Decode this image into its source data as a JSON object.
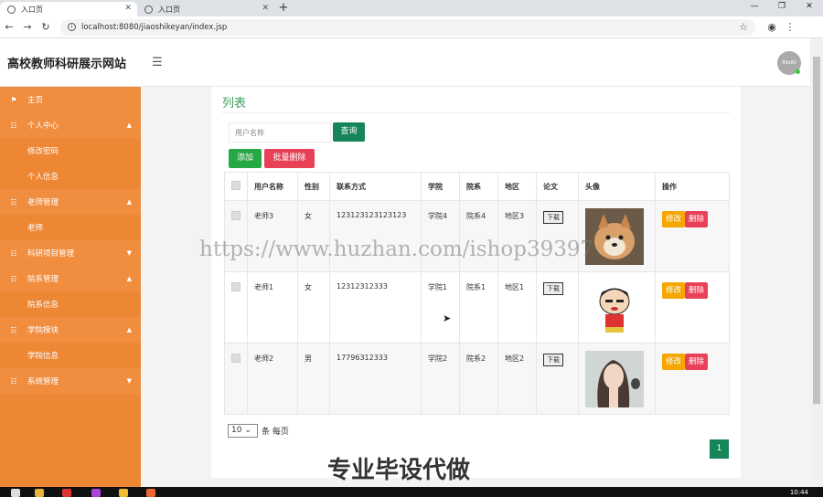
{
  "browser": {
    "tabs": [
      {
        "label": "入口页"
      },
      {
        "label": "入口页"
      }
    ],
    "url": "localhost:8080/jiaoshikeyan/index.jsp",
    "new_tab": "+",
    "win": {
      "min": "—",
      "max": "❐",
      "close": "✕"
    }
  },
  "header": {
    "title": "高校教师科研展示网站",
    "avatar_text": "80x80"
  },
  "sidebar": {
    "items": [
      {
        "label": "主页",
        "type": "main",
        "icon": "flag-icon"
      },
      {
        "label": "个人中心",
        "type": "main",
        "caret": "▲"
      },
      {
        "label": "修改密码",
        "type": "sub"
      },
      {
        "label": "个人信息",
        "type": "sub"
      },
      {
        "label": "老师管理",
        "type": "main",
        "caret": "▲"
      },
      {
        "label": "老师",
        "type": "sub"
      },
      {
        "label": "科研项目管理",
        "type": "main",
        "caret": "▼"
      },
      {
        "label": "院系管理",
        "type": "main",
        "caret": "▲"
      },
      {
        "label": "院系信息",
        "type": "sub"
      },
      {
        "label": "学院模块",
        "type": "main",
        "caret": "▲"
      },
      {
        "label": "学院信息",
        "type": "sub"
      },
      {
        "label": "系统管理",
        "type": "main",
        "caret": "▼"
      }
    ]
  },
  "main": {
    "title": "列表",
    "search_placeholder": "用户名称",
    "query_button": "查询",
    "add_button": "添加",
    "batch_delete_button": "批量删除",
    "columns": [
      "用户名称",
      "性别",
      "联系方式",
      "学院",
      "院系",
      "地区",
      "论文",
      "头像",
      "操作"
    ],
    "rows": [
      {
        "name": "老师3",
        "gender": "女",
        "contact": "123123123123123",
        "college": "学院4",
        "dept": "院系4",
        "region": "地区3",
        "paper": "下载",
        "avatar": "shiba-dog-photo"
      },
      {
        "name": "老师1",
        "gender": "女",
        "contact": "12312312333",
        "college": "学院1",
        "dept": "院系1",
        "region": "地区1",
        "paper": "下载",
        "avatar": "cartoon-boy-image"
      },
      {
        "name": "老师2",
        "gender": "男",
        "contact": "17796312333",
        "college": "学院2",
        "dept": "院系2",
        "region": "地区2",
        "paper": "下载",
        "avatar": "woman-portrait-photo"
      }
    ],
    "edit_label": "修改",
    "delete_label": "删除",
    "page_size": "10",
    "page_size_suffix": "条 每页",
    "page_number": "1"
  },
  "watermark": "https://www.huzhan.com/ishop39397",
  "overlay_text": "专业毕设代做",
  "taskbar": {
    "clock": "10:44"
  },
  "colors": {
    "sidebar": "#ee8734",
    "accent": "#16855a",
    "success": "#28a745",
    "danger": "#e74057",
    "warning": "#f5a700"
  }
}
